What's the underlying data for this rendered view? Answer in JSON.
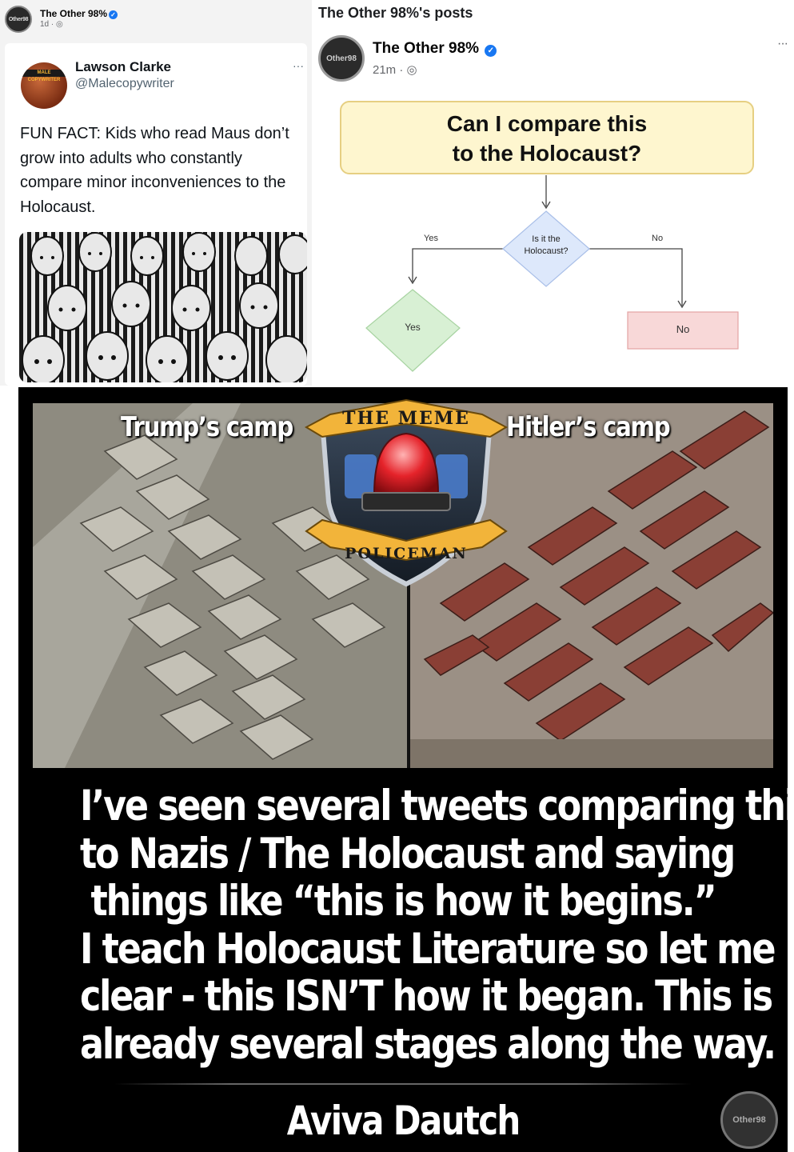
{
  "fb_small": {
    "avatar_text": "Other98",
    "name": "The Other 98%",
    "time": "1d · ◎"
  },
  "tweet": {
    "name": "Lawson Clarke",
    "handle": "@Malecopywriter",
    "more": "···",
    "avatar_banner": "MALE COPYWRITER",
    "text": "FUN FACT: Kids who read Maus don’t grow into adults who constantly compare minor inconveniences to the Holocaust."
  },
  "posts_page": {
    "title": "The Other 98%'s posts",
    "avatar_text": "Other98",
    "name": "The Other 98%",
    "time": "21m · ◎",
    "more": "···"
  },
  "flowchart": {
    "title_line1": "Can I compare this",
    "title_line2": "to the Holocaust?",
    "question_line1": "Is it the",
    "question_line2": "Holocaust?",
    "branch_yes": "Yes",
    "branch_no": "No",
    "result_yes": "Yes",
    "result_no": "No",
    "colors": {
      "title_fill": "#fef6cf",
      "question_fill": "#dde8fb",
      "yes_fill": "#d8f0d4",
      "no_fill": "#f8d8d8"
    }
  },
  "meme": {
    "label_left": "Trump’s camp",
    "label_right": "Hitler’s camp",
    "badge_top": "THE MEME",
    "badge_bottom": "POLICEMAN",
    "quote_lines": [
      "I’ve seen several tweets comparing this",
      "to Nazis / The Holocaust and saying",
      "things like “this is how it begins.”",
      "I teach Holocaust Literature so let me be",
      "clear - this ISN’T how it began. This is",
      "already several stages along the way."
    ],
    "author": "Aviva Dautch",
    "watermark": "Other98"
  }
}
